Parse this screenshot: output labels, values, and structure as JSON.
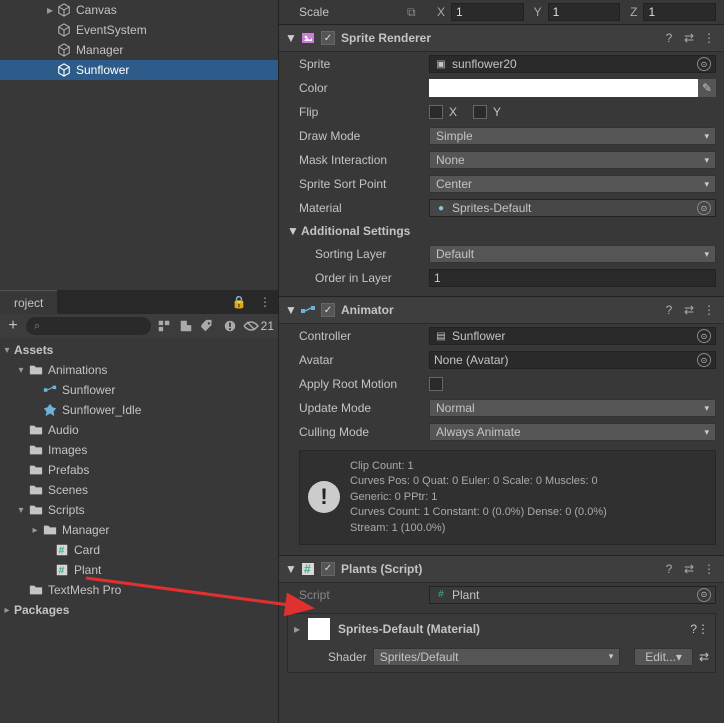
{
  "hierarchy": {
    "items": [
      {
        "label": "Canvas",
        "indent": 44,
        "fold": "▸"
      },
      {
        "label": "EventSystem",
        "indent": 56
      },
      {
        "label": "Manager",
        "indent": 56
      },
      {
        "label": "Sunflower",
        "indent": 56,
        "selected": true
      }
    ]
  },
  "project_tab": {
    "label": "roject"
  },
  "project_toolbar": {
    "search_placeholder": "",
    "visible_count": "21"
  },
  "assets_tree": {
    "root": "Assets",
    "items": [
      {
        "label": "Animations",
        "indent": 14,
        "icon": "folder",
        "fold": "▾"
      },
      {
        "label": "Sunflower",
        "indent": 28,
        "icon": "anim-ctrl"
      },
      {
        "label": "Sunflower_Idle",
        "indent": 28,
        "icon": "anim-clip"
      },
      {
        "label": "Audio",
        "indent": 14,
        "icon": "folder"
      },
      {
        "label": "Images",
        "indent": 14,
        "icon": "folder"
      },
      {
        "label": "Prefabs",
        "indent": 14,
        "icon": "folder"
      },
      {
        "label": "Scenes",
        "indent": 14,
        "icon": "folder"
      },
      {
        "label": "Scripts",
        "indent": 14,
        "icon": "folder",
        "fold": "▾"
      },
      {
        "label": "Manager",
        "indent": 28,
        "icon": "folder",
        "fold": "▸"
      },
      {
        "label": "Card",
        "indent": 40,
        "icon": "script"
      },
      {
        "label": "Plant",
        "indent": 40,
        "icon": "script"
      },
      {
        "label": "TextMesh Pro",
        "indent": 14,
        "icon": "folder"
      }
    ],
    "packages": "Packages"
  },
  "transform": {
    "scale_label": "Scale",
    "x_label": "X",
    "x": "1",
    "y_label": "Y",
    "y": "1",
    "z_label": "Z",
    "z": "1"
  },
  "sprite_renderer": {
    "title": "Sprite Renderer",
    "sprite_label": "Sprite",
    "sprite_value": "sunflower20",
    "color_label": "Color",
    "color_value": "#ffffff",
    "flip_label": "Flip",
    "flip_x": "X",
    "flip_y": "Y",
    "draw_mode_label": "Draw Mode",
    "draw_mode_value": "Simple",
    "mask_label": "Mask Interaction",
    "mask_value": "None",
    "sort_point_label": "Sprite Sort Point",
    "sort_point_value": "Center",
    "material_label": "Material",
    "material_value": "Sprites-Default",
    "additional_label": "Additional Settings",
    "sorting_layer_label": "Sorting Layer",
    "sorting_layer_value": "Default",
    "order_label": "Order in Layer",
    "order_value": "1"
  },
  "animator": {
    "title": "Animator",
    "controller_label": "Controller",
    "controller_value": "Sunflower",
    "avatar_label": "Avatar",
    "avatar_value": "None (Avatar)",
    "root_motion_label": "Apply Root Motion",
    "update_mode_label": "Update Mode",
    "update_mode_value": "Normal",
    "culling_label": "Culling Mode",
    "culling_value": "Always Animate",
    "info_lines": [
      "Clip Count: 1",
      "Curves Pos: 0 Quat: 0 Euler: 0 Scale: 0 Muscles: 0",
      "Generic: 0 PPtr: 1",
      "Curves Count: 1 Constant: 0 (0.0%) Dense: 0 (0.0%)",
      "Stream: 1 (100.0%)"
    ]
  },
  "plants_script": {
    "title": "Plants (Script)",
    "script_label": "Script",
    "script_value": "Plant"
  },
  "material_panel": {
    "title": "Sprites-Default (Material)",
    "shader_label": "Shader",
    "shader_value": "Sprites/Default",
    "edit_label": "Edit..."
  }
}
